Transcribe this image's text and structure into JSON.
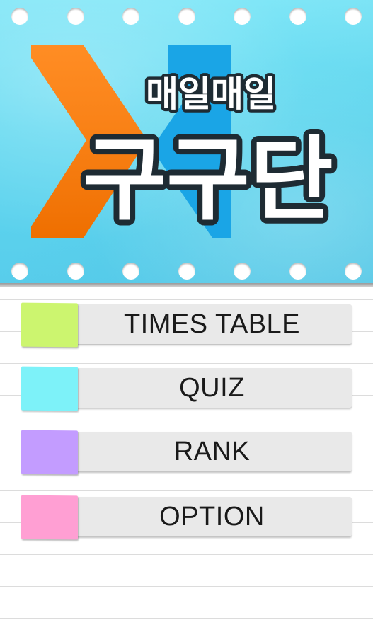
{
  "banner": {
    "subtitle": "매일매일",
    "title": "구구단",
    "colors": {
      "background": "#6fdcf3",
      "logo_orange": "#ff7a00",
      "logo_blue": "#1aa5e6",
      "text_fill": "#ffffff",
      "text_outline": "#1e2b33"
    }
  },
  "menu": [
    {
      "label": "TIMES TABLE",
      "color": "#ccf56f"
    },
    {
      "label": "QUIZ",
      "color": "#7df2f9"
    },
    {
      "label": "RANK",
      "color": "#c39cff"
    },
    {
      "label": "OPTION",
      "color": "#ff9fd3"
    }
  ]
}
